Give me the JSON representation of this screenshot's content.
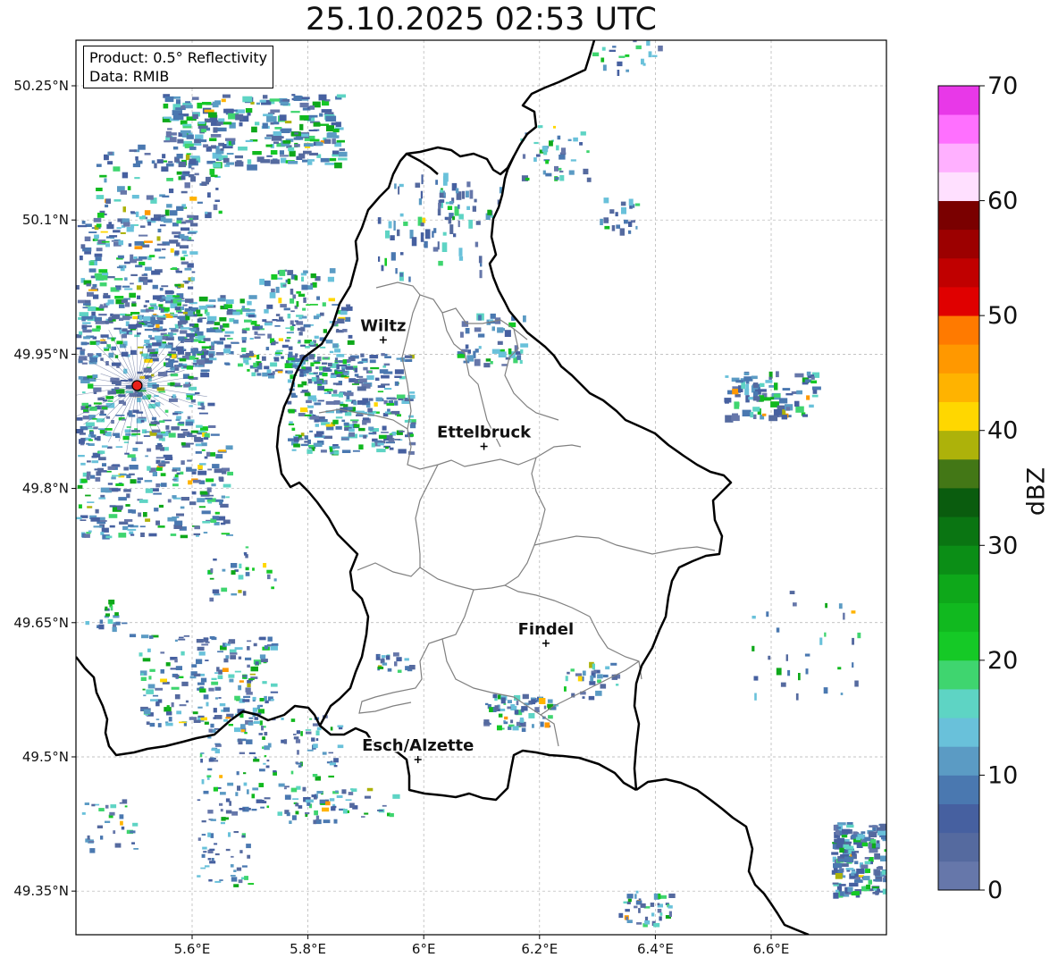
{
  "title": "25.10.2025 02:53 UTC",
  "info": {
    "product": "Product: 0.5° Reflectivity",
    "data": "Data: RMIB"
  },
  "cities": [
    {
      "name": "Wiltz",
      "lon": 5.93,
      "lat": 49.966
    },
    {
      "name": "Ettelbruck",
      "lon": 6.104,
      "lat": 49.847
    },
    {
      "name": "Findel",
      "lon": 6.211,
      "lat": 49.627
    },
    {
      "name": "Esch/Alzette",
      "lon": 5.99,
      "lat": 49.497
    }
  ],
  "radar_site": {
    "lon": 5.505,
    "lat": 49.915,
    "color": "#e8201a"
  },
  "map_extent": {
    "lon": [
      5.4,
      6.8
    ],
    "lat": [
      49.3,
      50.3
    ]
  },
  "lon_ticks": [
    {
      "value": 5.6,
      "label": "5.6°E"
    },
    {
      "value": 5.8,
      "label": "5.8°E"
    },
    {
      "value": 6.0,
      "label": "6°E"
    },
    {
      "value": 6.2,
      "label": "6.2°E"
    },
    {
      "value": 6.4,
      "label": "6.4°E"
    },
    {
      "value": 6.6,
      "label": "6.6°E"
    }
  ],
  "lat_ticks": [
    {
      "value": 50.25,
      "label": "50.25°N"
    },
    {
      "value": 50.1,
      "label": "50.1°N"
    },
    {
      "value": 49.95,
      "label": "49.95°N"
    },
    {
      "value": 49.8,
      "label": "49.8°N"
    },
    {
      "value": 49.65,
      "label": "49.65°N"
    },
    {
      "value": 49.5,
      "label": "49.5°N"
    },
    {
      "value": 49.35,
      "label": "49.35°N"
    }
  ],
  "colorbar": {
    "label": "dBZ",
    "range": [
      0,
      70
    ],
    "ticks": [
      "0",
      "10",
      "20",
      "30",
      "40",
      "50",
      "60",
      "70"
    ],
    "colors": [
      "#6677aa",
      "#556a9f",
      "#4660a0",
      "#4a78b0",
      "#5b9bc4",
      "#69c1da",
      "#5ed4c4",
      "#3fd56f",
      "#15c926",
      "#11b91f",
      "#0ea81a",
      "#0b8e16",
      "#0a7512",
      "#0a5c0e",
      "#437716",
      "#adb20a",
      "#ffd700",
      "#ffb300",
      "#ff9800",
      "#ff7a00",
      "#e00000",
      "#c00000",
      "#9c0000",
      "#7a0000",
      "#ffe0ff",
      "#ffb0ff",
      "#ff70ff",
      "#e838e8"
    ]
  },
  "palette": {
    "border": "#000000",
    "district": "#808080",
    "grid": "#b0b0b0"
  }
}
